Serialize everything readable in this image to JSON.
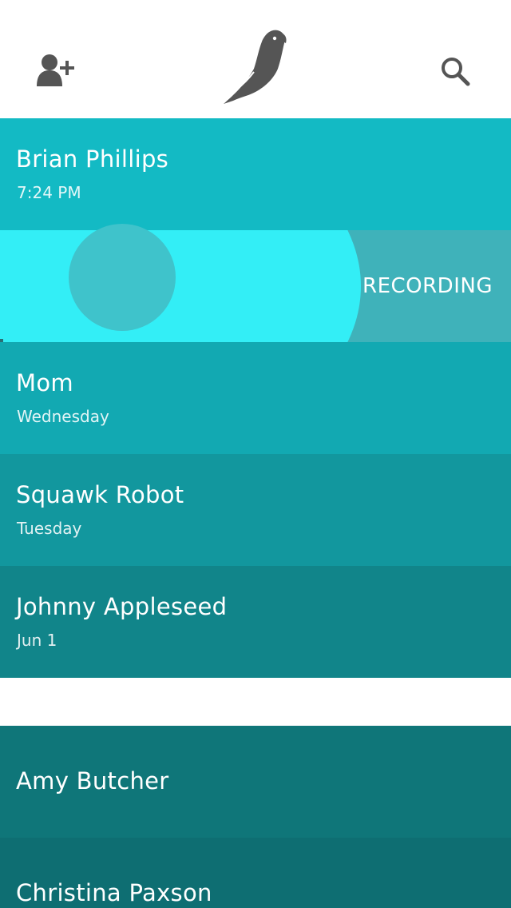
{
  "header": {
    "add_contact_icon": "add-person-icon",
    "logo_icon": "parrot-logo-icon",
    "search_icon": "search-icon"
  },
  "colors": {
    "row_1": "#13bac4",
    "recording_fill": "#33eef6",
    "recording_track": "#3fb2ba",
    "row_3": "#12a9b2",
    "row_4": "#12979e",
    "row_5": "#11858a",
    "row_6": "#0f7679",
    "row_7": "#0e6e72",
    "icon": "#555555"
  },
  "conversations": [
    {
      "name": "Brian Phillips",
      "time": "7:24 PM"
    },
    {
      "name": "Mom",
      "time": "Wednesday"
    },
    {
      "name": "Squawk Robot",
      "time": "Tuesday"
    },
    {
      "name": "Johnny Appleseed",
      "time": "Jun 1"
    }
  ],
  "contacts": [
    {
      "name": "Amy Butcher"
    },
    {
      "name": "Christina Paxson"
    }
  ],
  "recording": {
    "label": "RECORDING"
  }
}
